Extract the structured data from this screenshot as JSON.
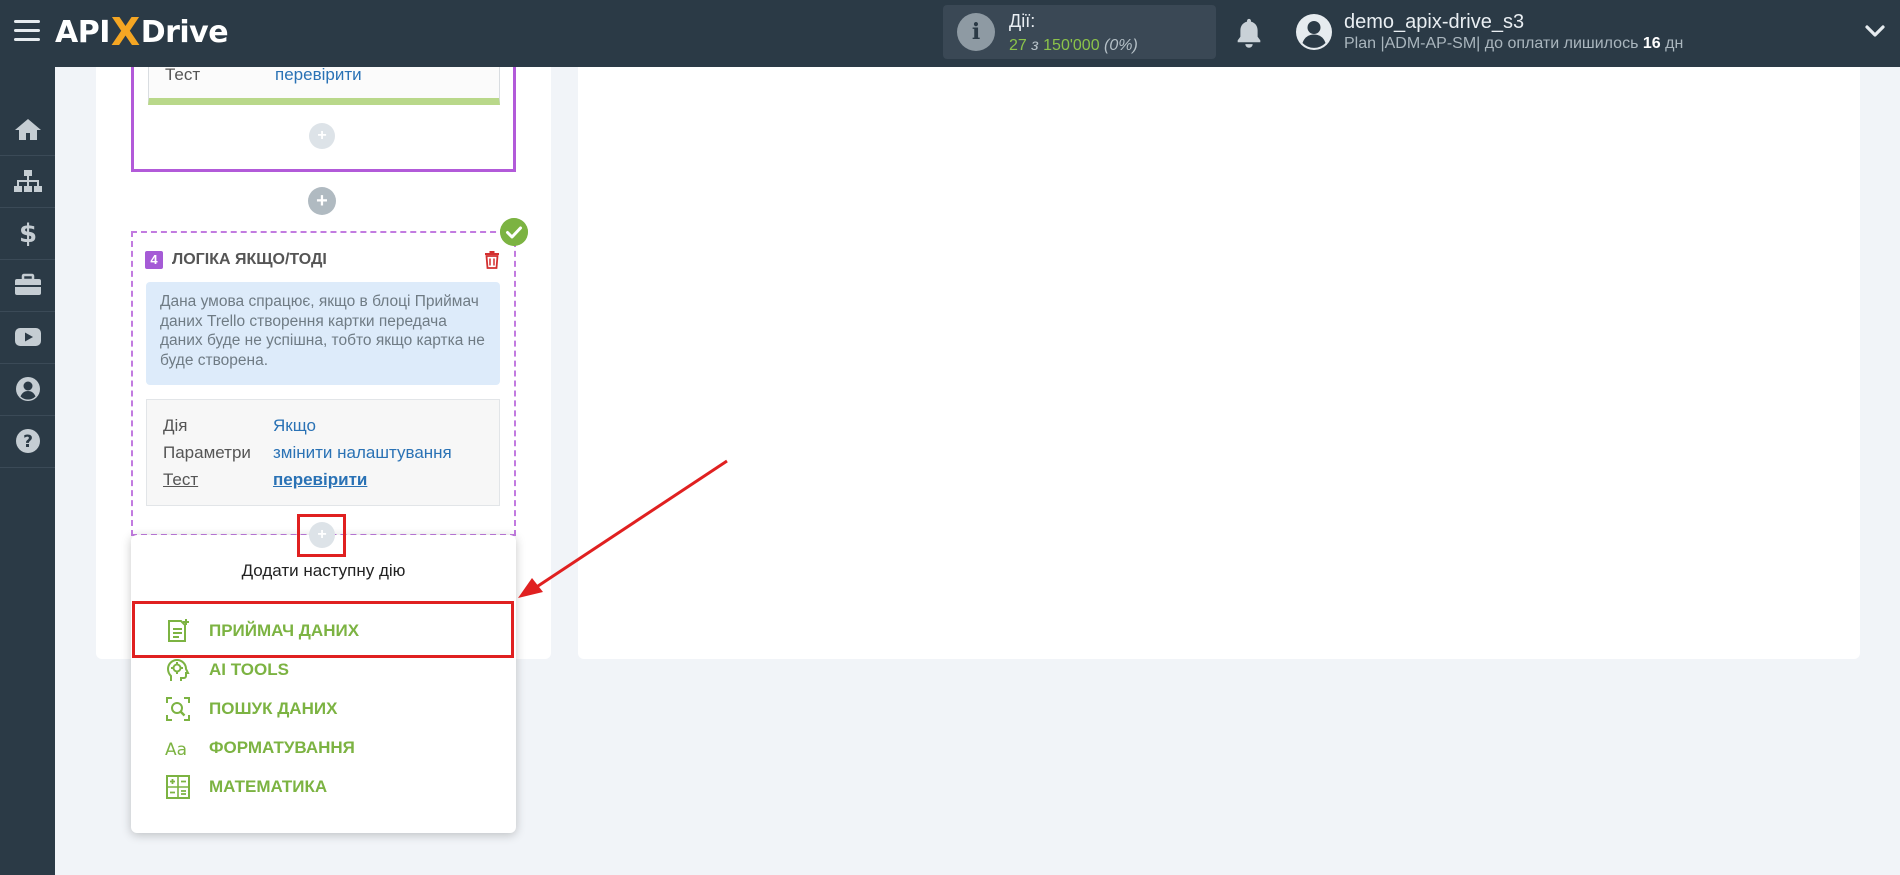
{
  "header": {
    "logo_api": "API",
    "logo_x": "X",
    "logo_drive": "Drive",
    "actions_icon": "i",
    "actions_label": "Дії:",
    "actions_used": "27",
    "actions_of": "з",
    "actions_limit": "150'000",
    "actions_percent": "(0%)",
    "user_name": "demo_apix-drive_s3",
    "plan_text": "Plan |ADM-AP-SM| до оплати лишилось",
    "plan_days": "16",
    "plan_days_unit": "дн"
  },
  "sidebar": {
    "items": [
      {
        "icon": "home-icon"
      },
      {
        "icon": "sitemap-icon"
      },
      {
        "icon": "dollar-icon"
      },
      {
        "icon": "briefcase-icon"
      },
      {
        "icon": "youtube-icon"
      },
      {
        "icon": "user-icon"
      },
      {
        "icon": "help-icon"
      }
    ]
  },
  "block3": {
    "test_label": "Тест",
    "test_value": "перевірити"
  },
  "plus_symbol": "+",
  "block4": {
    "number": "4",
    "title": "ЛОГІКА ЯКЩО/ТОДІ",
    "info": "Дана умова спрацює, якщо в блоці Приймач даних Trello створення картки передача даних буде не успішна, тобто якщо картка не буде створена.",
    "rows": [
      {
        "label": "Дія",
        "value": "Якщо"
      },
      {
        "label": "Параметри",
        "value": "змінити налаштування"
      },
      {
        "label": "Тест",
        "value": "перевірити"
      }
    ]
  },
  "dropdown": {
    "title": "Додати наступну дію",
    "items": [
      {
        "label": "ПРИЙМАЧ ДАНИХ",
        "icon": "data-receiver-icon"
      },
      {
        "label": "AI TOOLS",
        "icon": "ai-head-icon"
      },
      {
        "label": "ПОШУК ДАНИХ",
        "icon": "search-data-icon"
      },
      {
        "label": "ФОРМАТУВАННЯ",
        "icon": "text-format-icon"
      },
      {
        "label": "МАТЕМАТИКА",
        "icon": "calculator-icon"
      }
    ]
  },
  "colors": {
    "topbar": "#2b3a46",
    "accent_green": "#7cb342",
    "accent_purple": "#b25ad9",
    "link_blue": "#2a72b5",
    "highlight_red": "#e02020"
  }
}
